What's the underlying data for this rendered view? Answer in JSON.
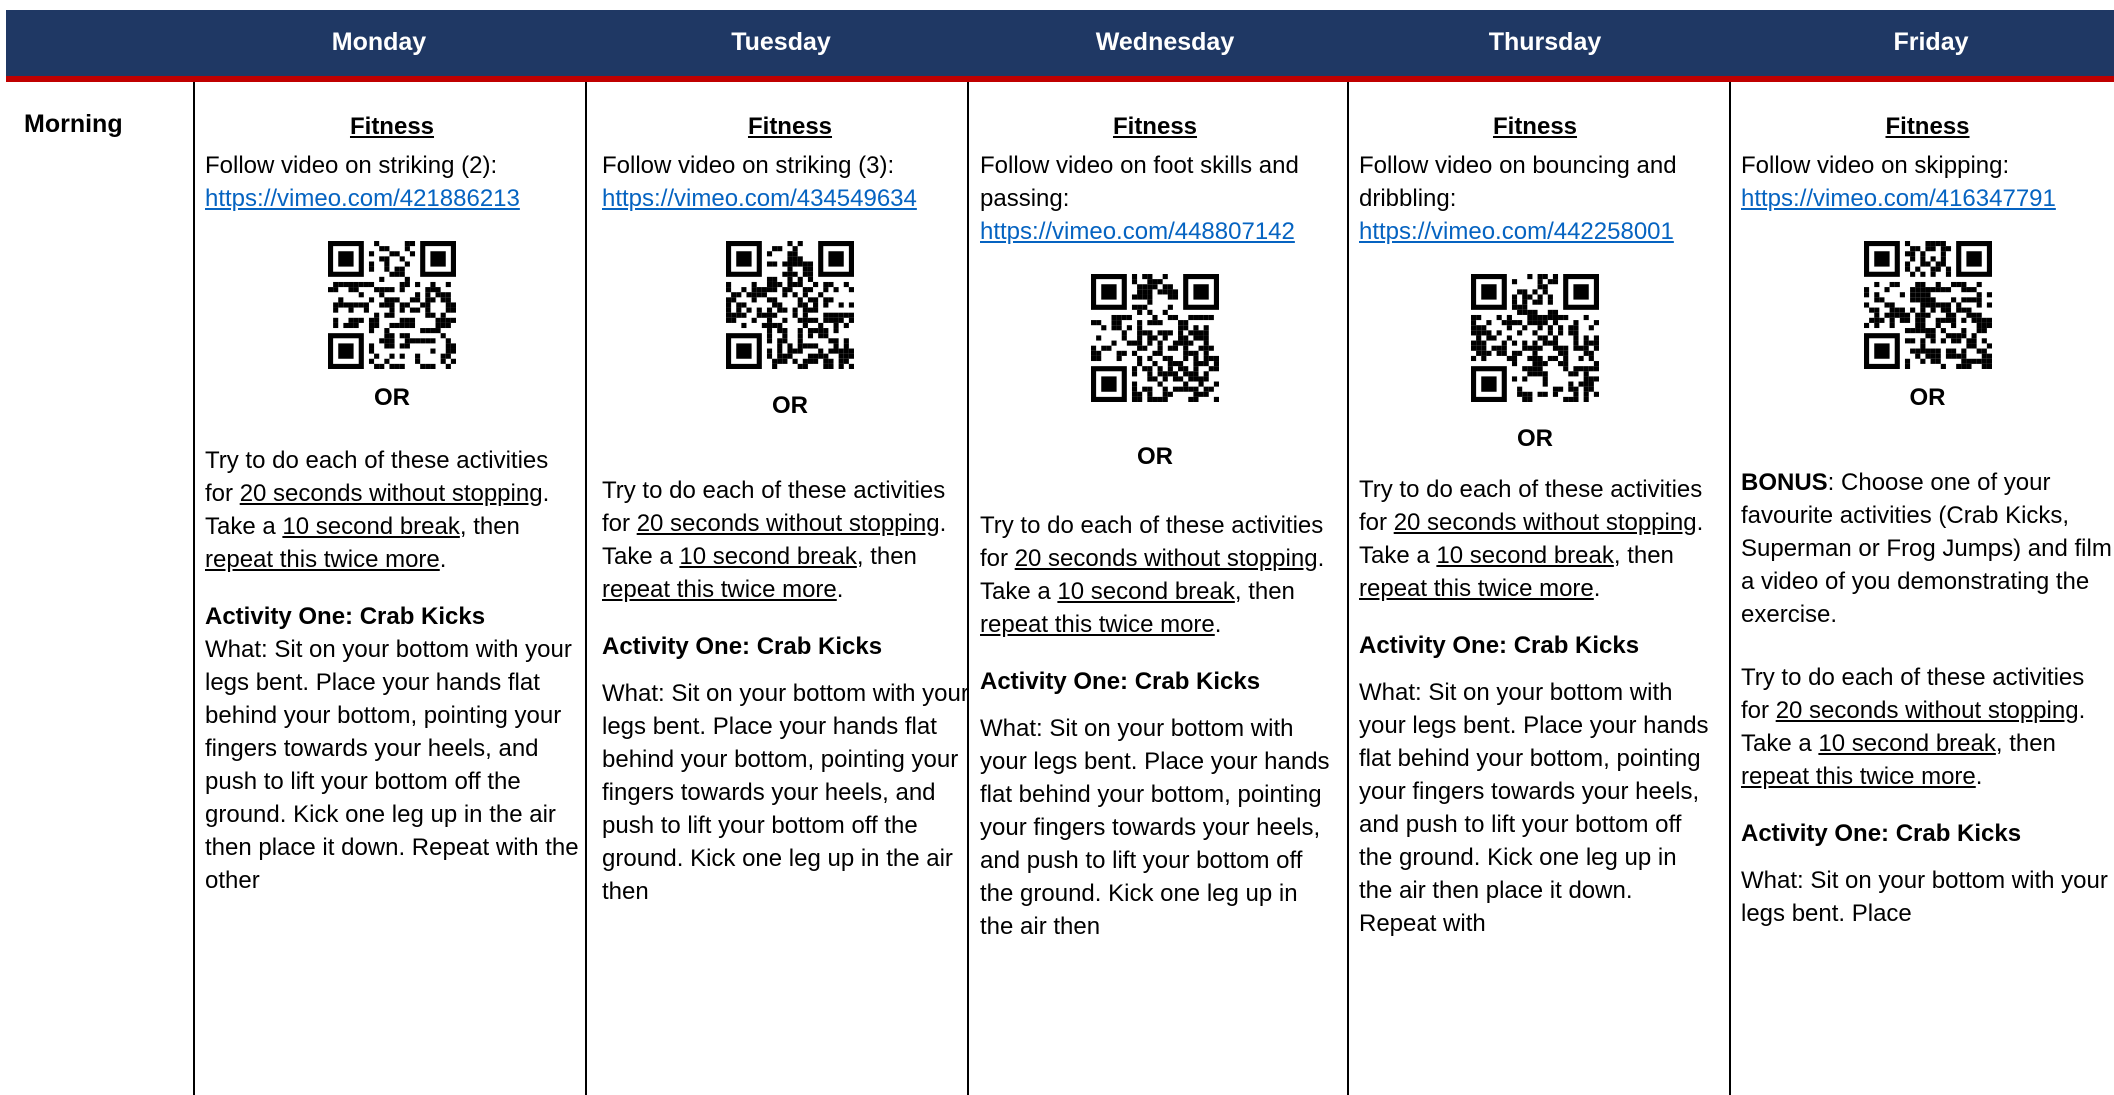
{
  "header": {
    "days": [
      "Monday",
      "Tuesday",
      "Wednesday",
      "Thursday",
      "Friday"
    ]
  },
  "row": {
    "label": "Morning"
  },
  "common": {
    "section_title": "Fitness",
    "or_label": "OR",
    "try_intro": "Try to do each of these activities for ",
    "try_20s": "20 seconds without stopping",
    "try_mid": ". Take a ",
    "try_break": "10 second break",
    "try_then": ", then ",
    "try_repeat": "repeat this twice more",
    "try_end": ".",
    "activity_title": "Activity One: Crab Kicks",
    "activity_text_mon": "What: Sit on your bottom with your legs bent. Place your hands flat behind your bottom, pointing your fingers towards your heels, and push to lift your bottom off the ground. Kick one leg up in the air then place it down. Repeat with the other",
    "activity_text_tue": "What: Sit on your bottom with your legs bent. Place your hands flat behind your bottom, pointing your fingers towards your heels, and push to lift your bottom off the ground. Kick one leg up in the air then",
    "activity_text_wed": "What: Sit on your bottom with your legs bent. Place your hands flat behind your bottom, pointing your fingers towards your heels, and push to lift your bottom off the ground. Kick one leg up in the air then",
    "activity_text_thu": "What: Sit on your bottom with your legs bent. Place your hands flat behind your bottom, pointing your fingers towards your heels, and push to lift your bottom off the ground. Kick one leg up in the air then place it down. Repeat with",
    "activity_text_fri": "What: Sit on your bottom with your legs bent. Place"
  },
  "monday": {
    "intro": "Follow video on striking (2):",
    "link": "https://vimeo.com/421886213"
  },
  "tuesday": {
    "intro": "Follow video on striking (3):",
    "link": "https://vimeo.com/434549634"
  },
  "wednesday": {
    "intro": "Follow video on foot skills and passing:",
    "link": "https://vimeo.com/448807142"
  },
  "thursday": {
    "intro": "Follow video on bouncing and dribbling:",
    "link": "https://vimeo.com/442258001"
  },
  "friday": {
    "intro": "Follow video on skipping:",
    "link": "https://vimeo.com/416347791",
    "bonus_label": "BONUS",
    "bonus_text": ": Choose one of your favourite activities (Crab Kicks, Superman or Frog Jumps) and film a video of you demonstrating the exercise."
  },
  "colors": {
    "header_bg": "#1f3864",
    "header_rule": "#c00000",
    "link": "#0563c1"
  }
}
